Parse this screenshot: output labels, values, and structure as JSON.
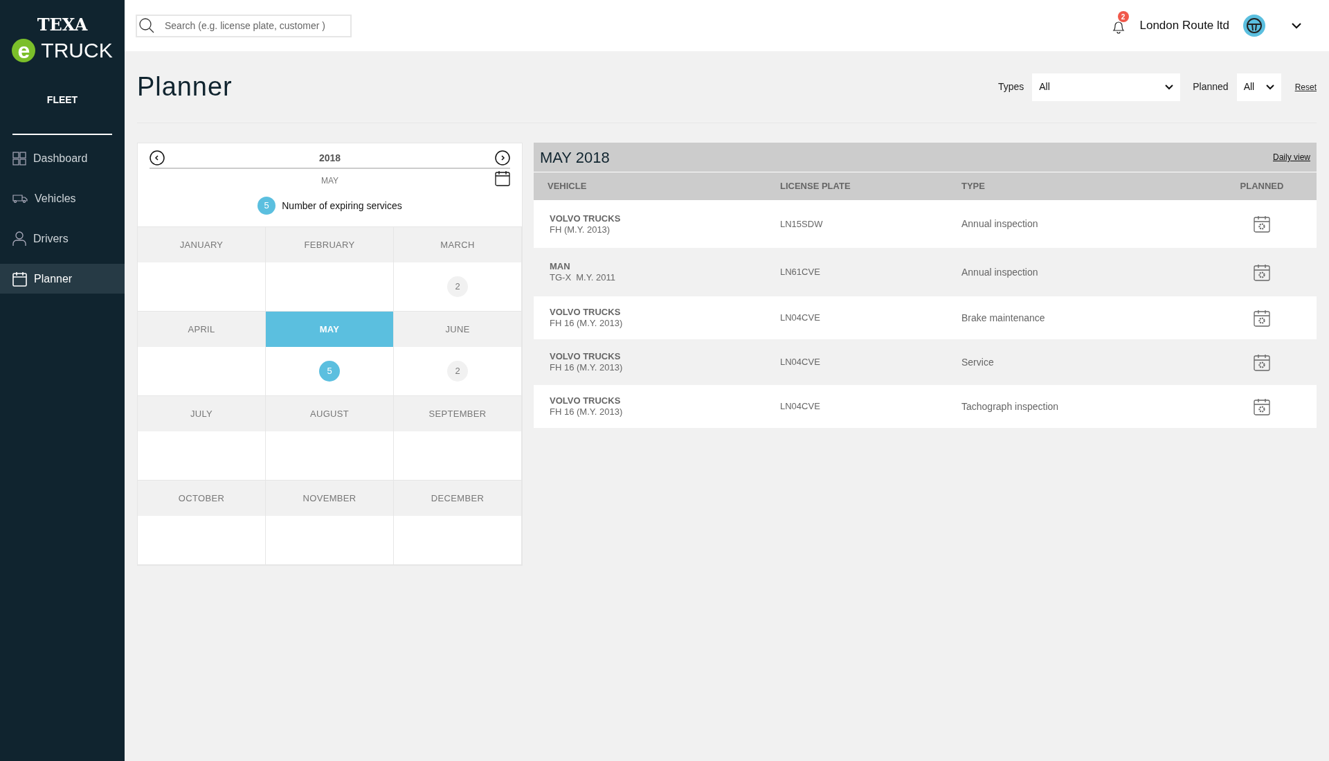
{
  "logo": {
    "brand": "TEXA",
    "letter": "e",
    "product": "TRUCK"
  },
  "sidebar": {
    "section": "FLEET",
    "items": [
      {
        "kind": "dashboard",
        "label": "Dashboard",
        "selected": false
      },
      {
        "kind": "vehicles",
        "label": "Vehicles",
        "selected": false
      },
      {
        "kind": "drivers",
        "label": "Drivers",
        "selected": false
      },
      {
        "kind": "planner",
        "label": "Planner",
        "selected": true
      }
    ]
  },
  "header": {
    "search": {
      "placeholder": "Search (e.g. license plate, customer )"
    },
    "notifications": "2",
    "company": "London Route ltd"
  },
  "page": {
    "title": "Planner",
    "filters": [
      {
        "label": "Types",
        "value": "All",
        "kind": "wide"
      },
      {
        "label": "Planned",
        "value": "All",
        "kind": "narrow"
      }
    ],
    "reset": "Reset"
  },
  "calendar": {
    "year": "2018",
    "month": "MAY",
    "legend": {
      "count": "5",
      "text": "Number of expiring services"
    },
    "months": [
      {
        "name": "JANUARY",
        "selected": false
      },
      {
        "name": "FEBRUARY",
        "selected": false
      },
      {
        "name": "MARCH",
        "count": "2",
        "selected": false
      },
      {
        "name": "APRIL",
        "selected": false
      },
      {
        "name": "MAY",
        "count": "5",
        "selected": true
      },
      {
        "name": "JUNE",
        "count": "2",
        "selected": false
      },
      {
        "name": "JULY",
        "selected": false
      },
      {
        "name": "AUGUST",
        "selected": false
      },
      {
        "name": "SEPTEMBER",
        "selected": false
      },
      {
        "name": "OCTOBER",
        "selected": false
      },
      {
        "name": "NOVEMBER",
        "selected": false
      },
      {
        "name": "DECEMBER",
        "selected": false
      }
    ]
  },
  "table": {
    "title": "MAY 2018",
    "daily_view": "Daily view",
    "columns": [
      "VEHICLE",
      "LICENSE PLATE",
      "TYPE",
      "PLANNED"
    ],
    "rows": [
      {
        "make": "VOLVO TRUCKS",
        "model": "FH (M.Y. 2013)",
        "plate": "LN15SDW",
        "type": "Annual inspection"
      },
      {
        "make": "MAN",
        "model": "TG-X  M.Y. 2011",
        "plate": "LN61CVE",
        "type": "Annual inspection"
      },
      {
        "make": "VOLVO TRUCKS",
        "model": "FH 16 (M.Y. 2013)",
        "plate": "LN04CVE",
        "type": "Brake maintenance"
      },
      {
        "make": "VOLVO TRUCKS",
        "model": "FH 16 (M.Y. 2013)",
        "plate": "LN04CVE",
        "type": "Service"
      },
      {
        "make": "VOLVO TRUCKS",
        "model": "FH 16 (M.Y. 2013)",
        "plate": "LN04CVE",
        "type": "Tachograph inspection"
      }
    ]
  }
}
